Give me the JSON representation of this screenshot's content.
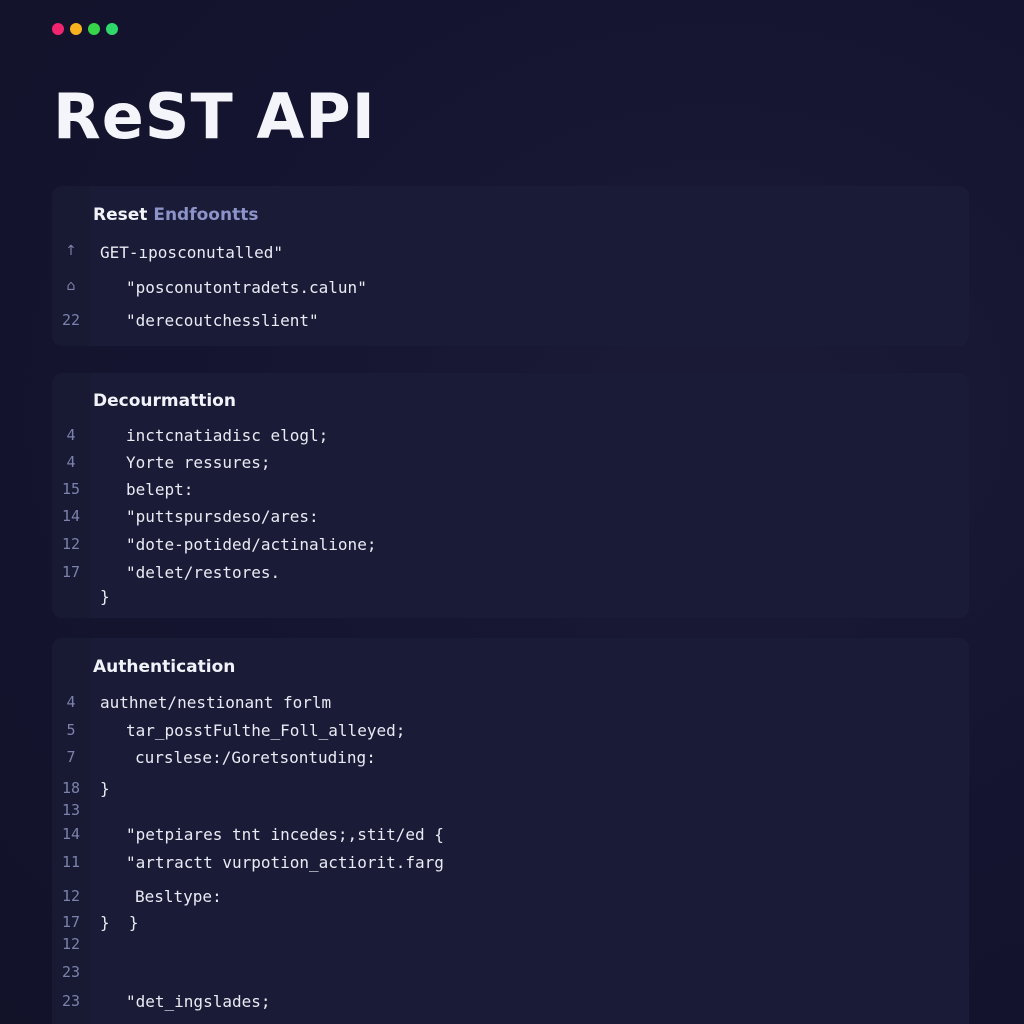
{
  "window": {
    "traffic_lights": [
      "#f0256e",
      "#f7b21e",
      "#37d64a",
      "#2fd86a"
    ]
  },
  "page": {
    "title": "ReST API"
  },
  "panels": [
    {
      "title_main": "Reset ",
      "title_accent": "Endfoontts",
      "lines": [
        {
          "num": "↑",
          "text": "GET-ıposconutalled\""
        },
        {
          "num": "⌂",
          "text": "\"posconutontradets.calun\""
        },
        {
          "num": "22",
          "text": "\"derecoutchesslient\""
        }
      ]
    },
    {
      "title_main": "Decourmattion",
      "lines": [
        {
          "num": "4",
          "text": "inctcnatiadisc elogl;"
        },
        {
          "num": "4",
          "text": "Yorte ressures;"
        },
        {
          "num": "15",
          "text": "belept:"
        },
        {
          "num": "14",
          "text": "\"puttspursdeso/ares:"
        },
        {
          "num": "12",
          "text": "\"dote-potided/actinalione;"
        },
        {
          "num": "17",
          "text": "\"delet/restores."
        },
        {
          "num": "",
          "text": "}"
        }
      ]
    },
    {
      "title_main": "Authentication",
      "lines": [
        {
          "num": "4",
          "text": "authnet/nestionant forlm"
        },
        {
          "num": "5",
          "text": "tar_posstFulthe_Foll_alleyed;"
        },
        {
          "num": "7",
          "text": "curslese:/Goretsontuding:"
        },
        {
          "num": "18",
          "text": "}"
        },
        {
          "num": "13",
          "text": ""
        },
        {
          "num": "14",
          "text": "\"petpiares tnt incedes;,stit/ed {"
        },
        {
          "num": "11",
          "text": "\"artractt vurpotion_actiorit.farg"
        },
        {
          "num": "12",
          "text": "Besltype:"
        },
        {
          "num": "17",
          "text": "}  }"
        },
        {
          "num": "12",
          "text": ""
        },
        {
          "num": "23",
          "text": ""
        },
        {
          "num": "23",
          "text": "\"det_ingslades;"
        }
      ]
    }
  ]
}
